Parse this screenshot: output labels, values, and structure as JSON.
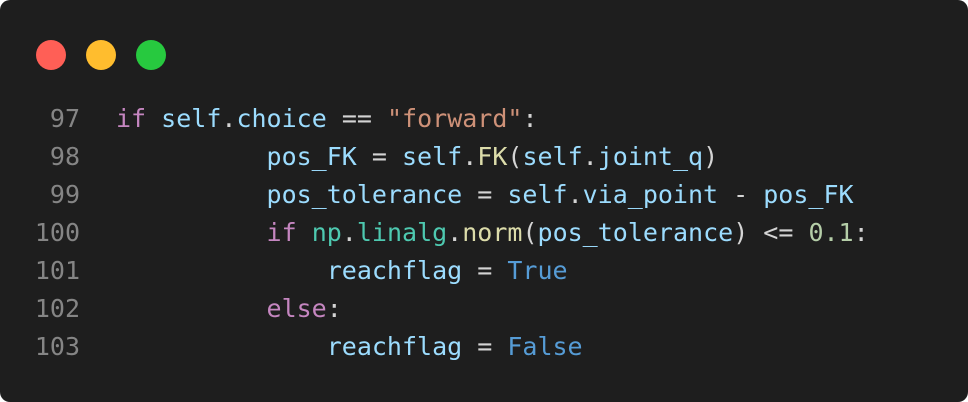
{
  "window": {
    "controls": [
      {
        "name": "close",
        "color": "#ff5f56"
      },
      {
        "name": "minimize",
        "color": "#ffbd2e"
      },
      {
        "name": "maximize",
        "color": "#27c93f"
      }
    ]
  },
  "code": {
    "lines": [
      {
        "number": "97",
        "indent": "",
        "tokens": [
          {
            "t": "if",
            "c": "kw"
          },
          {
            "t": " ",
            "c": "op"
          },
          {
            "t": "self",
            "c": "var"
          },
          {
            "t": ".",
            "c": "op"
          },
          {
            "t": "choice",
            "c": "var"
          },
          {
            "t": " == ",
            "c": "op"
          },
          {
            "t": "\"forward\"",
            "c": "str"
          },
          {
            "t": ":",
            "c": "op"
          }
        ]
      },
      {
        "number": "98",
        "indent": "          ",
        "tokens": [
          {
            "t": "pos_FK",
            "c": "var"
          },
          {
            "t": " = ",
            "c": "op"
          },
          {
            "t": "self",
            "c": "var"
          },
          {
            "t": ".",
            "c": "op"
          },
          {
            "t": "FK",
            "c": "fn"
          },
          {
            "t": "(",
            "c": "op"
          },
          {
            "t": "self",
            "c": "var"
          },
          {
            "t": ".",
            "c": "op"
          },
          {
            "t": "joint_q",
            "c": "var"
          },
          {
            "t": ")",
            "c": "op"
          }
        ]
      },
      {
        "number": "99",
        "indent": "          ",
        "tokens": [
          {
            "t": "pos_tolerance",
            "c": "var"
          },
          {
            "t": " = ",
            "c": "op"
          },
          {
            "t": "self",
            "c": "var"
          },
          {
            "t": ".",
            "c": "op"
          },
          {
            "t": "via_point",
            "c": "var"
          },
          {
            "t": " - ",
            "c": "op"
          },
          {
            "t": "pos_FK",
            "c": "var"
          }
        ]
      },
      {
        "number": "100",
        "indent": "          ",
        "tokens": [
          {
            "t": "if",
            "c": "kw"
          },
          {
            "t": " ",
            "c": "op"
          },
          {
            "t": "np",
            "c": "mod"
          },
          {
            "t": ".",
            "c": "op"
          },
          {
            "t": "linalg",
            "c": "mod"
          },
          {
            "t": ".",
            "c": "op"
          },
          {
            "t": "norm",
            "c": "fn"
          },
          {
            "t": "(",
            "c": "op"
          },
          {
            "t": "pos_tolerance",
            "c": "var"
          },
          {
            "t": ") <= ",
            "c": "op"
          },
          {
            "t": "0.1",
            "c": "num"
          },
          {
            "t": ":",
            "c": "op"
          }
        ]
      },
      {
        "number": "101",
        "indent": "              ",
        "tokens": [
          {
            "t": "reachflag",
            "c": "var"
          },
          {
            "t": " = ",
            "c": "op"
          },
          {
            "t": "True",
            "c": "const"
          }
        ]
      },
      {
        "number": "102",
        "indent": "          ",
        "tokens": [
          {
            "t": "else",
            "c": "kw"
          },
          {
            "t": ":",
            "c": "op"
          }
        ]
      },
      {
        "number": "103",
        "indent": "              ",
        "tokens": [
          {
            "t": "reachflag",
            "c": "var"
          },
          {
            "t": " = ",
            "c": "op"
          },
          {
            "t": "False",
            "c": "const"
          }
        ]
      }
    ]
  }
}
